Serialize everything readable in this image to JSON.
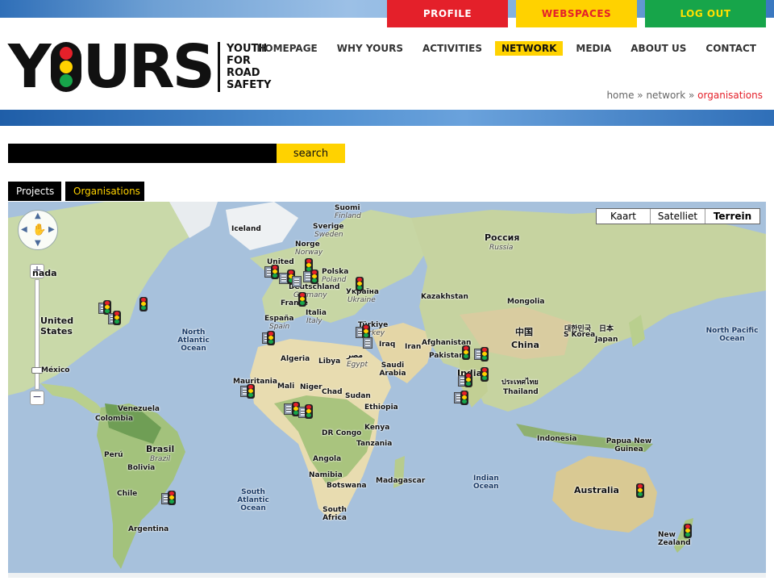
{
  "top_buttons": {
    "profile": "PROFILE",
    "webspaces": "WEBSPACES",
    "logout": "LOG OUT"
  },
  "logo": {
    "word_left": "Y",
    "word_right": "URS",
    "tag": [
      "YOUTH",
      "FOR",
      "ROAD",
      "SAFETY"
    ]
  },
  "nav": [
    {
      "label": "HOMEPAGE",
      "active": false
    },
    {
      "label": "WHY YOURS",
      "active": false
    },
    {
      "label": "ACTIVITIES",
      "active": false
    },
    {
      "label": "NETWORK",
      "active": true
    },
    {
      "label": "MEDIA",
      "active": false
    },
    {
      "label": "ABOUT US",
      "active": false
    },
    {
      "label": "CONTACT",
      "active": false
    }
  ],
  "breadcrumb": {
    "home": "home",
    "sep": " » ",
    "network": "network",
    "current": "organisations"
  },
  "search": {
    "value": "",
    "button": "search"
  },
  "tabs": {
    "projects": "Projects",
    "organisations": "Organisations"
  },
  "map": {
    "types": [
      "Kaart",
      "Satelliet",
      "Terrein"
    ],
    "selected_type": "Terrein",
    "zoom_plus": "+",
    "zoom_minus": "−",
    "labels": {
      "suomi": "Suomi",
      "finland": "Finland",
      "iceland": "Iceland",
      "sverige": "Sverige",
      "sweden": "Sweden",
      "norge": "Norge",
      "norway": "Norway",
      "united": "United",
      "polska": "Polska",
      "poland": "Poland",
      "deutschland": "Deutschland",
      "germany": "Germany",
      "ukraina": "Україна",
      "ukraine": "Ukraine",
      "france": "France",
      "italia": "Italia",
      "italy": "Italy",
      "espana": "España",
      "spain": "Spain",
      "turkiye": "Türkiye",
      "turkey": "Turkey",
      "rossiya": "Россия",
      "russia": "Russia",
      "kazakhstan": "Kazakhstan",
      "mongolia": "Mongolia",
      "china_native": "中国",
      "china": "China",
      "korea_native": "대한민국",
      "skorea": "S Korea",
      "japan_native": "日本",
      "japan": "Japan",
      "canada": "nada",
      "united_states": "United States",
      "mexico": "México",
      "north_atlantic": "North Atlantic Ocean",
      "north_pacific": "North Pacific Ocean",
      "algeria": "Algeria",
      "libya": "Libya",
      "egypt_native": "مصر",
      "egypt": "Egypt",
      "iraq": "Iraq",
      "iran": "Iran",
      "afghanistan": "Afghanistan",
      "pakistan": "Pakistan",
      "saudi": "Saudi Arabia",
      "india": "India",
      "thailand_native": "ประเทศไทย",
      "thailand": "Thailand",
      "mauritania": "Mauritania",
      "mali": "Mali",
      "niger": "Niger",
      "chad": "Chad",
      "sudan": "Sudan",
      "ethiopia": "Ethiopia",
      "kenya": "Kenya",
      "drcongo": "DR Congo",
      "tanzania": "Tanzania",
      "angola": "Angola",
      "namibia": "Namibia",
      "botswana": "Botswana",
      "madagascar": "Madagascar",
      "south_africa": "South Africa",
      "indonesia": "Indonesia",
      "png": "Papua New Guinea",
      "australia": "Australia",
      "new_zealand": "New Zealand",
      "indian_ocean": "Indian Ocean",
      "south_atlantic": "South Atlantic Ocean",
      "venezuela": "Venezuela",
      "colombia": "Colombia",
      "brasil": "Brasil",
      "brazil": "Brazil",
      "peru": "Perú",
      "bolivia": "Bolivia",
      "chile": "Chile",
      "argentina": "Argentina"
    }
  }
}
